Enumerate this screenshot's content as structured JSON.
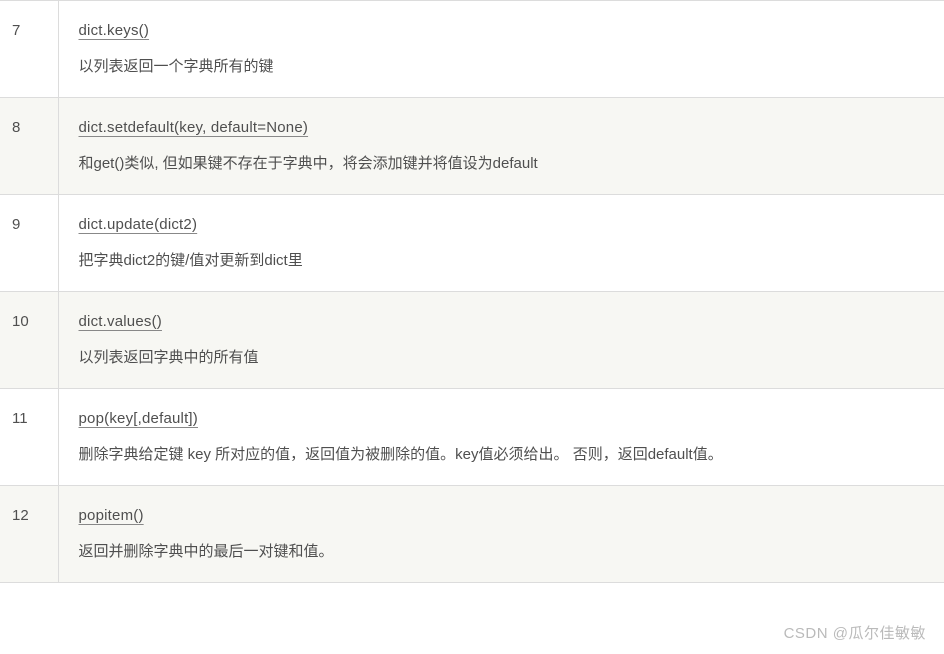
{
  "rows": [
    {
      "num": "7",
      "method": "dict.keys()",
      "desc": "以列表返回一个字典所有的键"
    },
    {
      "num": "8",
      "method": "dict.setdefault(key, default=None)",
      "desc": "和get()类似, 但如果键不存在于字典中，将会添加键并将值设为default"
    },
    {
      "num": "9",
      "method": "dict.update(dict2)",
      "desc": "把字典dict2的键/值对更新到dict里"
    },
    {
      "num": "10",
      "method": "dict.values()",
      "desc": "以列表返回字典中的所有值"
    },
    {
      "num": "11",
      "method": "pop(key[,default])",
      "desc": "删除字典给定键 key 所对应的值，返回值为被删除的值。key值必须给出。 否则，返回default值。"
    },
    {
      "num": "12",
      "method": "popitem()",
      "desc": "返回并删除字典中的最后一对键和值。"
    }
  ],
  "watermark": "CSDN @瓜尔佳敏敏"
}
